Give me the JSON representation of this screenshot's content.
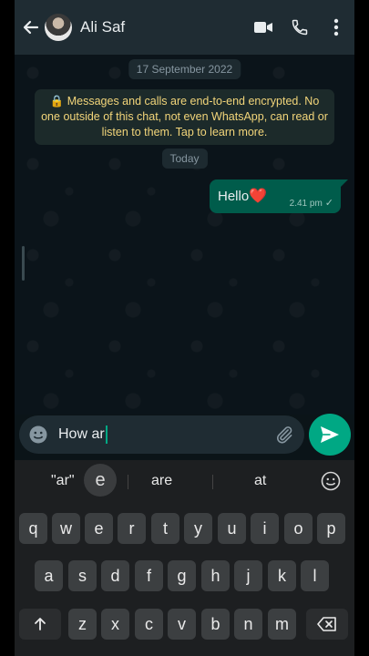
{
  "header": {
    "contact_name": "Ali Saf",
    "back_icon": "arrow-left-icon",
    "video_icon": "video-camera-icon",
    "call_icon": "phone-icon",
    "menu_icon": "more-vertical-icon"
  },
  "chat": {
    "date_label": "17 September 2022",
    "encryption_notice": "🔒 Messages and calls are end-to-end encrypted. No one outside of this chat, not even WhatsApp, can read or listen to them. Tap to learn more.",
    "today_label": "Today",
    "messages": [
      {
        "text": "Hello",
        "emoji": "❤️",
        "time": "2.41 pm",
        "status": "✓"
      }
    ]
  },
  "input": {
    "value": "How ar",
    "emoji_icon": "emoji-icon",
    "attach_icon": "paperclip-icon",
    "send_icon": "send-icon"
  },
  "keyboard": {
    "suggestions": [
      "\"ar\"",
      "are",
      "at"
    ],
    "popup_key": "e",
    "emoji_icon": "emoji-icon",
    "row1": [
      "q",
      "w",
      "e",
      "r",
      "t",
      "y",
      "u",
      "i",
      "o",
      "p"
    ],
    "row2": [
      "a",
      "s",
      "d",
      "f",
      "g",
      "h",
      "j",
      "k",
      "l"
    ],
    "row3": [
      "z",
      "x",
      "c",
      "v",
      "b",
      "n",
      "m"
    ],
    "shift_icon": "shift-arrow-icon",
    "backspace_icon": "backspace-icon"
  },
  "colors": {
    "accent": "#00a884",
    "bubble_out": "#005c4b",
    "header_bg": "#1f2c33",
    "encryption_text": "#f2d57a"
  }
}
